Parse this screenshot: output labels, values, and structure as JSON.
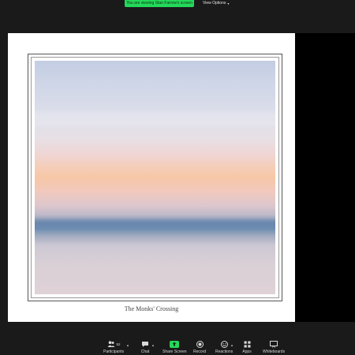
{
  "banner": {
    "sharing_text": "You are viewing Stan Farrow's screen",
    "view_options_label": "View Options"
  },
  "shared_content": {
    "caption": "The Monks' Crossing"
  },
  "toolbar": {
    "participants_label": "Participants",
    "participants_count": "52",
    "chat_label": "Chat",
    "share_screen_label": "Share Screen",
    "record_label": "Record",
    "reactions_label": "Reactions",
    "apps_label": "Apps",
    "whiteboards_label": "Whiteboards"
  },
  "colors": {
    "share_green": "#23d959",
    "background": "#1a1a1a"
  }
}
